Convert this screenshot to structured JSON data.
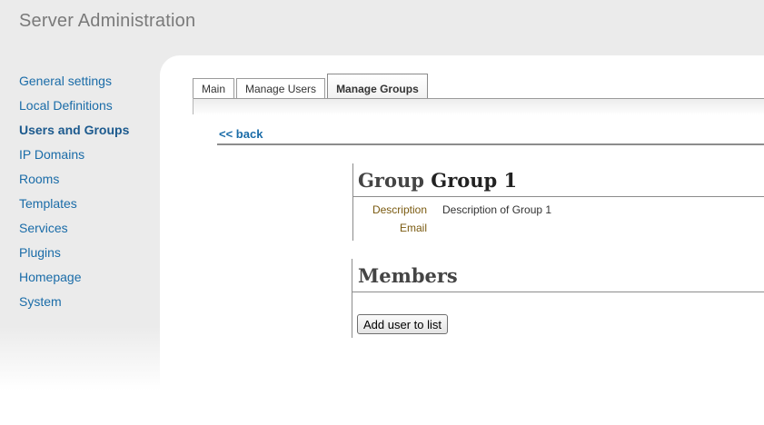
{
  "app": {
    "title": "Server Administration"
  },
  "sidebar": {
    "items": [
      {
        "label": "General settings"
      },
      {
        "label": "Local Definitions"
      },
      {
        "label": "Users and Groups"
      },
      {
        "label": "IP Domains"
      },
      {
        "label": "Rooms"
      },
      {
        "label": "Templates"
      },
      {
        "label": "Services"
      },
      {
        "label": "Plugins"
      },
      {
        "label": "Homepage"
      },
      {
        "label": "System"
      }
    ],
    "active_item": "Users and Groups"
  },
  "tabs": [
    {
      "label": "Main"
    },
    {
      "label": "Manage Users"
    },
    {
      "label": "Manage Groups"
    }
  ],
  "active_tab": "Manage Groups",
  "back_link": "<< back",
  "group": {
    "title_prefix": "Group",
    "name": "Group 1",
    "fields": {
      "description_label": "Description",
      "description_value": "Description of Group 1",
      "email_label": "Email",
      "email_value": ""
    }
  },
  "members": {
    "title": "Members",
    "add_button": "Add user to list"
  },
  "colors": {
    "link": "#1a6ca8",
    "background": "#ebebeb",
    "label": "#7a5a10"
  }
}
